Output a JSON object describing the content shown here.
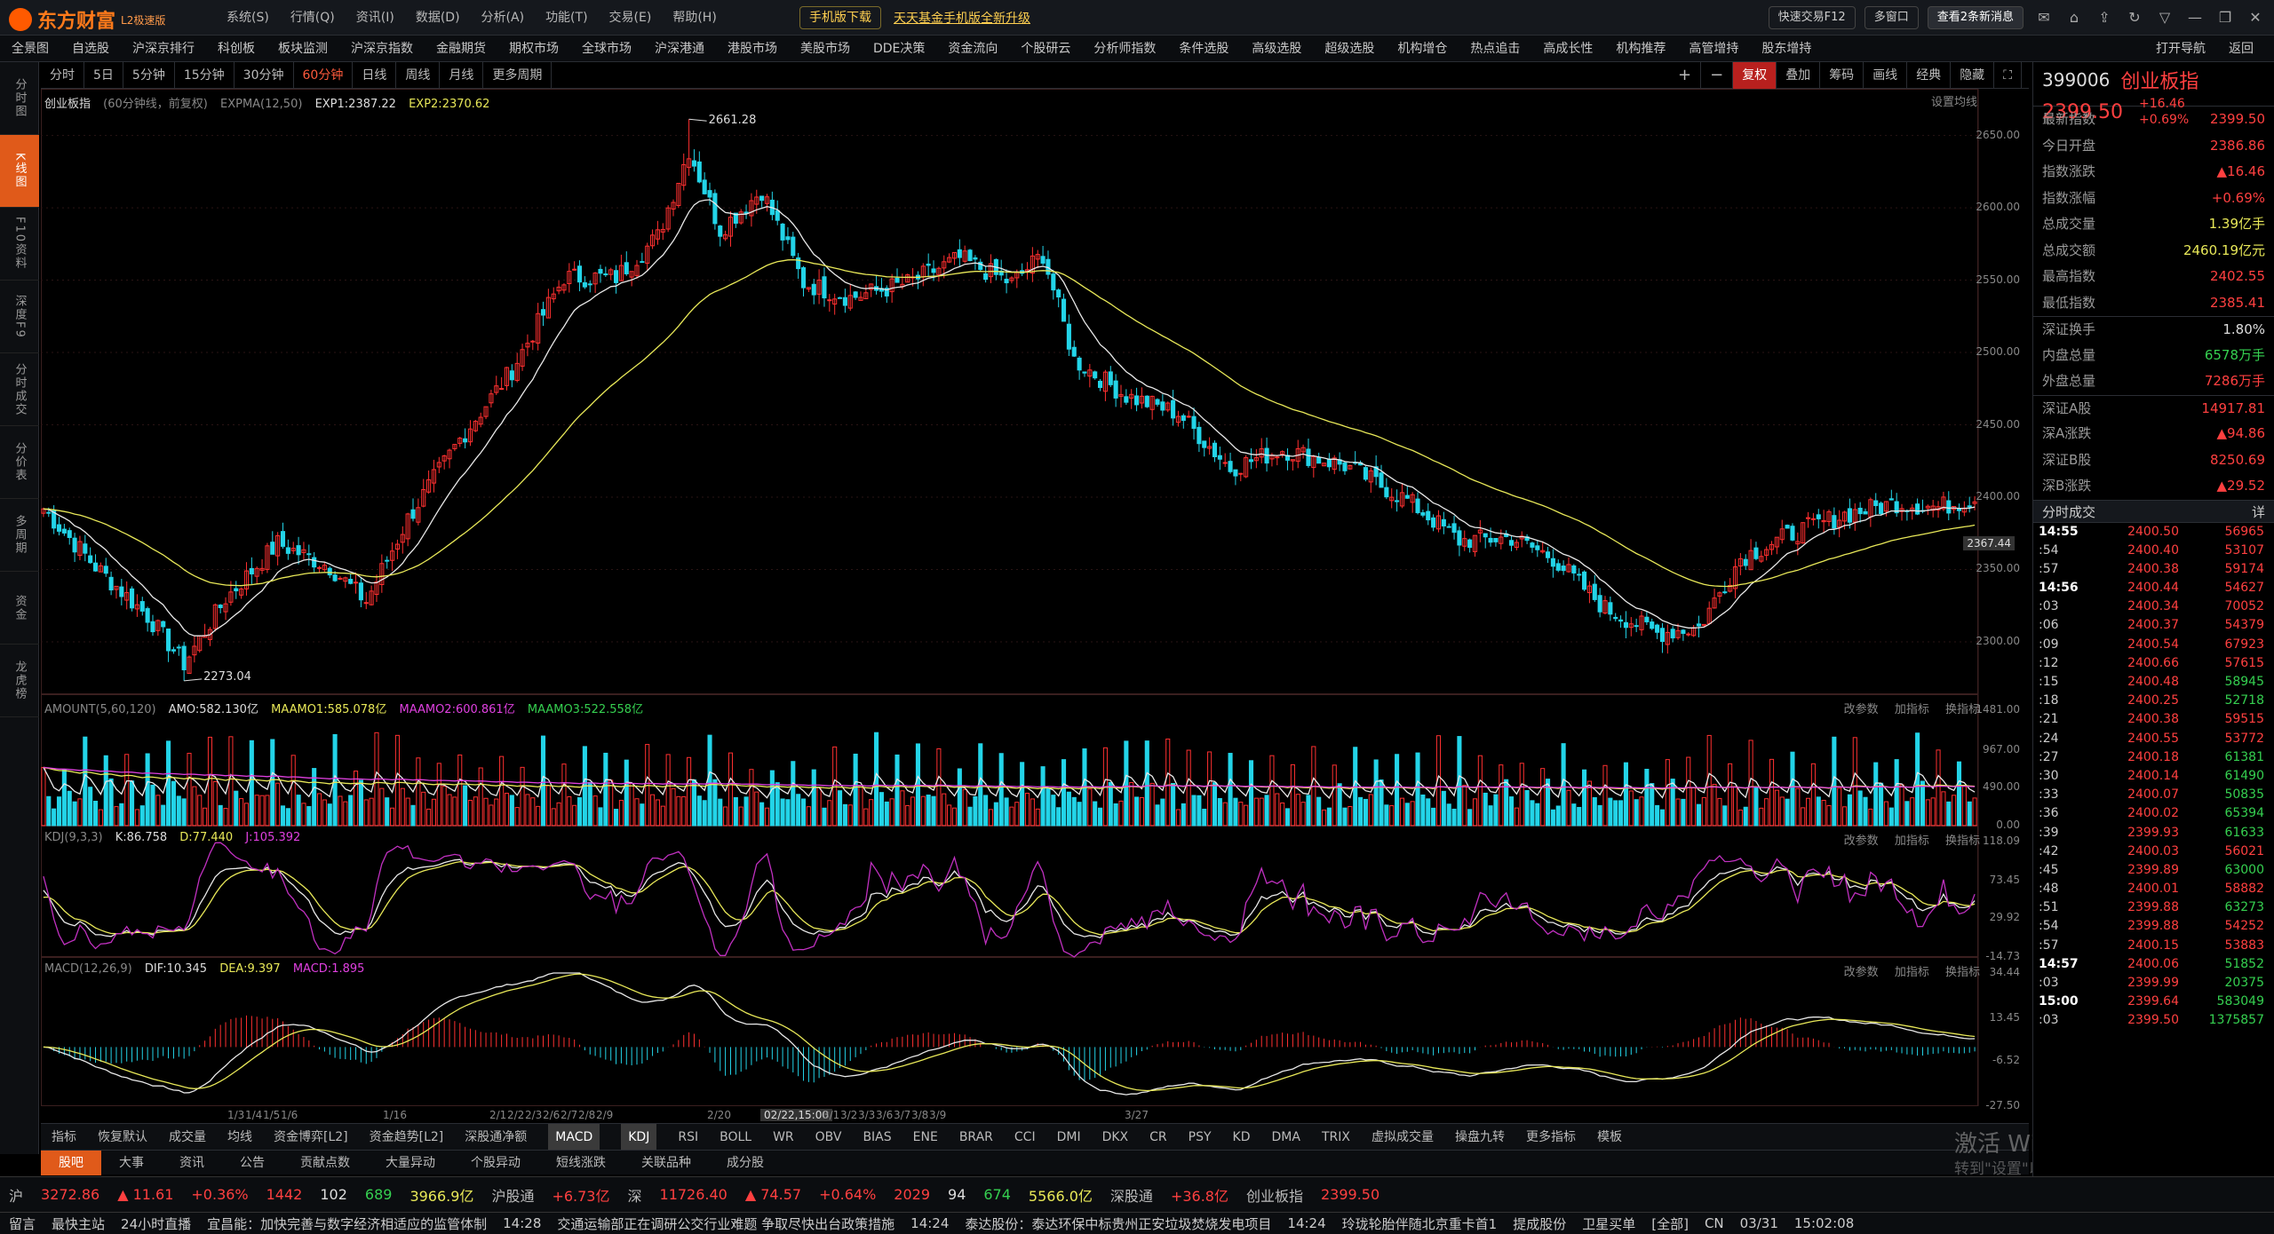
{
  "app": {
    "logo": "东方财富",
    "edition": "L2极速版"
  },
  "menu": [
    "系统(S)",
    "行情(Q)",
    "资讯(I)",
    "数据(D)",
    "分析(A)",
    "功能(T)",
    "交易(E)",
    "帮助(H)"
  ],
  "promo": {
    "download": "手机版下载",
    "link": "天天基金手机版全新升级"
  },
  "topright": {
    "quicktrade": "快速交易F12",
    "multiwin": "多窗口",
    "news": "查看2条新消息",
    "news_badge": "2"
  },
  "nav": [
    "全景图",
    "自选股",
    "沪深京排行",
    "科创板",
    "板块监测",
    "沪深京指数",
    "金融期货",
    "期权市场",
    "全球市场",
    "沪深港通",
    "港股市场",
    "美股市场",
    "DDE决策",
    "资金流向",
    "个股研云",
    "分析师指数",
    "条件选股",
    "高级选股",
    "超级选股",
    "机构增仓",
    "热点追击",
    "高成长性",
    "机构推荐",
    "高管增持",
    "股东增持"
  ],
  "nav_right": [
    "打开导航",
    "返回"
  ],
  "leftbar": [
    "分时图",
    "K线图",
    "F10资料",
    "深度F9",
    "分时成交",
    "分价表",
    "多周期",
    "资金",
    "龙虎榜"
  ],
  "periods": [
    "分时",
    "5日",
    "5分钟",
    "15分钟",
    "30分钟",
    "60分钟",
    "日线",
    "周线",
    "月线",
    "更多周期"
  ],
  "period_tools": [
    "复权",
    "叠加",
    "筹码",
    "画线",
    "经典",
    "隐藏"
  ],
  "main": {
    "name": "创业板指",
    "desc": "(60分钟线，前复权)",
    "ind": "EXPMA(12,50)",
    "exp1": "EXP1:2387.22",
    "exp2": "EXP2:2370.62",
    "setting": "设置均线",
    "hi_label": "2661.28",
    "lo_label": "2273.04",
    "focus_price": "2367.44"
  },
  "main_axis": [
    "2650.00",
    "2600.00",
    "2550.00",
    "2500.00",
    "2450.00",
    "2400.00",
    "2350.00",
    "2300.00"
  ],
  "vol": {
    "name": "AMOUNT(5,60,120)",
    "amo": "AMO:582.130亿",
    "m1": "MAAMO1:585.078亿",
    "m2": "MAAMO2:600.861亿",
    "m3": "MAAMO3:522.558亿"
  },
  "vol_axis": [
    "1481.00",
    "967.00",
    "490.00",
    "0.00"
  ],
  "kdj": {
    "name": "KDJ(9,3,3)",
    "k": "K:86.758",
    "d": "D:77.440",
    "j": "J:105.392"
  },
  "kdj_axis": [
    "118.09",
    "73.45",
    "29.92",
    "-14.73"
  ],
  "macd": {
    "name": "MACD(12,26,9)",
    "dif": "DIF:10.345",
    "dea": "DEA:9.397",
    "macd": "MACD:1.895"
  },
  "macd_axis": [
    "34.44",
    "13.45",
    "-6.52",
    "-27.50"
  ],
  "panel_btns": [
    "改参数",
    "加指标",
    "换指标"
  ],
  "xaxis": [
    "1/3",
    "1/4",
    "1/5",
    "1/6",
    "1/16",
    "2/1",
    "2/2",
    "2/3",
    "2/6",
    "2/7",
    "2/8",
    "2/9",
    "2/20",
    "02/22,15:00",
    "3/1",
    "3/2",
    "3/3",
    "3/6",
    "3/7",
    "3/8",
    "3/9",
    "3/27"
  ],
  "indicators": [
    "指标",
    "恢复默认",
    "成交量",
    "均线",
    "资金博弈[L2]",
    "资金趋势[L2]",
    "深股通净额",
    "MACD",
    "KDJ",
    "RSI",
    "BOLL",
    "WR",
    "OBV",
    "BIAS",
    "ENE",
    "BRAR",
    "CCI",
    "DMI",
    "DKX",
    "CR",
    "PSY",
    "KD",
    "DMA",
    "TRIX",
    "虚拟成交量",
    "操盘九转",
    "更多指标",
    "模板"
  ],
  "bottom_tabs": [
    "股吧",
    "大事",
    "资讯",
    "公告",
    "贡献点数",
    "大量异动",
    "个股异动",
    "短线涨跌",
    "关联品种",
    "成分股"
  ],
  "quote": {
    "code": "399006",
    "name": "创业板指",
    "price": "2399.50",
    "chg": "+16.46",
    "pct": "+0.69%"
  },
  "stats": [
    {
      "k": "最新指数",
      "v": "2399.50",
      "c": "red"
    },
    {
      "k": "今日开盘",
      "v": "2386.86",
      "c": "red"
    },
    {
      "k": "指数涨跌",
      "v": "▲16.46",
      "c": "red"
    },
    {
      "k": "指数涨幅",
      "v": "+0.69%",
      "c": "red"
    },
    {
      "k": "总成交量",
      "v": "1.39亿手",
      "c": "yellow"
    },
    {
      "k": "总成交额",
      "v": "2460.19亿元",
      "c": "yellow"
    },
    {
      "k": "最高指数",
      "v": "2402.55",
      "c": "red"
    },
    {
      "k": "最低指数",
      "v": "2385.41",
      "c": "red"
    },
    {
      "k": "深证换手",
      "v": "1.80%",
      "c": "white"
    },
    {
      "k": "内盘总量",
      "v": "6578万手",
      "c": "green"
    },
    {
      "k": "外盘总量",
      "v": "7286万手",
      "c": "red"
    },
    {
      "k": "深证A股",
      "v": "14917.81",
      "c": "red"
    },
    {
      "k": "深A涨跌",
      "v": "▲94.86",
      "c": "red"
    },
    {
      "k": "深证B股",
      "v": "8250.69",
      "c": "red"
    },
    {
      "k": "深B涨跌",
      "v": "▲29.52",
      "c": "red"
    }
  ],
  "ticks_title": "分时成交",
  "ticks_btn": "详",
  "ticks": [
    {
      "t": "14:55",
      "p": "2400.50",
      "v": "56965",
      "c": "red",
      "big": true
    },
    {
      "t": ":54",
      "p": "2400.40",
      "v": "53107",
      "c": "red"
    },
    {
      "t": ":57",
      "p": "2400.38",
      "v": "59174",
      "c": "red"
    },
    {
      "t": "14:56",
      "p": "2400.44",
      "v": "54627",
      "c": "red",
      "big": true
    },
    {
      "t": ":03",
      "p": "2400.34",
      "v": "70052",
      "c": "red"
    },
    {
      "t": ":06",
      "p": "2400.37",
      "v": "54379",
      "c": "red"
    },
    {
      "t": ":09",
      "p": "2400.54",
      "v": "67923",
      "c": "red"
    },
    {
      "t": ":12",
      "p": "2400.66",
      "v": "57615",
      "c": "red"
    },
    {
      "t": ":15",
      "p": "2400.48",
      "v": "58945",
      "c": "green"
    },
    {
      "t": ":18",
      "p": "2400.25",
      "v": "52718",
      "c": "green"
    },
    {
      "t": ":21",
      "p": "2400.38",
      "v": "59515",
      "c": "red"
    },
    {
      "t": ":24",
      "p": "2400.55",
      "v": "53772",
      "c": "red"
    },
    {
      "t": ":27",
      "p": "2400.18",
      "v": "61381",
      "c": "green"
    },
    {
      "t": ":30",
      "p": "2400.14",
      "v": "61490",
      "c": "green"
    },
    {
      "t": ":33",
      "p": "2400.07",
      "v": "50835",
      "c": "green"
    },
    {
      "t": ":36",
      "p": "2400.02",
      "v": "65394",
      "c": "green"
    },
    {
      "t": ":39",
      "p": "2399.93",
      "v": "61633",
      "c": "green"
    },
    {
      "t": ":42",
      "p": "2400.03",
      "v": "56021",
      "c": "red"
    },
    {
      "t": ":45",
      "p": "2399.89",
      "v": "63000",
      "c": "green"
    },
    {
      "t": ":48",
      "p": "2400.01",
      "v": "58882",
      "c": "red"
    },
    {
      "t": ":51",
      "p": "2399.88",
      "v": "63273",
      "c": "green"
    },
    {
      "t": ":54",
      "p": "2399.88",
      "v": "54252",
      "c": "red"
    },
    {
      "t": ":57",
      "p": "2400.15",
      "v": "53883",
      "c": "red"
    },
    {
      "t": "14:57",
      "p": "2400.06",
      "v": "51852",
      "c": "green",
      "big": true
    },
    {
      "t": ":03",
      "p": "2399.99",
      "v": "20375",
      "c": "green"
    },
    {
      "t": "15:00",
      "p": "2399.64",
      "v": "583049",
      "c": "green",
      "big": true
    },
    {
      "t": ":03",
      "p": "2399.50",
      "v": "1375857",
      "c": "green"
    }
  ],
  "status": [
    {
      "label": "沪",
      "v": "3272.86",
      "c": "red"
    },
    {
      "v": "▲ 11.61",
      "c": "red"
    },
    {
      "v": "+0.36%",
      "c": "red"
    },
    {
      "v": "1442",
      "c": "red"
    },
    {
      "v": "102",
      "c": "white"
    },
    {
      "v": "689",
      "c": "green"
    },
    {
      "v": "3966.9亿",
      "c": "yellow"
    },
    {
      "label": "沪股通",
      "v": "+6.73亿",
      "c": "red"
    },
    {
      "label": "深",
      "v": "11726.40",
      "c": "red"
    },
    {
      "v": "▲ 74.57",
      "c": "red"
    },
    {
      "v": "+0.64%",
      "c": "red"
    },
    {
      "v": "2029",
      "c": "red"
    },
    {
      "v": "94",
      "c": "white"
    },
    {
      "v": "674",
      "c": "green"
    },
    {
      "v": "5566.0亿",
      "c": "yellow"
    },
    {
      "label": "深股通",
      "v": "+36.8亿",
      "c": "red"
    },
    {
      "label": "创业板指",
      "v": "2399.50",
      "c": "red"
    }
  ],
  "news": [
    "留言",
    "最快主站",
    "24小时直播",
    "宜昌能：加快完善与数字经济相适应的监管体制",
    "14:28",
    "交通运输部正在调研公交行业难题 争取尽快出台政策措施",
    "14:24",
    "泰达股份：泰达环保中标贵州正安垃圾焚烧发电项目",
    "14:24",
    "玲珑轮胎伴随北京重卡首1",
    "提成股份",
    "卫星买单",
    "[全部]",
    "CN",
    "03/31",
    "15:02:08"
  ],
  "watermark": {
    "line1": "激活 Windows",
    "line2": "转到\"设置\"以激活 Windows。"
  },
  "chart_data": {
    "type": "candlestick",
    "title": "创业板指 (60分钟线，前复权)",
    "ylim": [
      2265,
      2670
    ],
    "hi": 2661.28,
    "lo": 2273.04,
    "anchors": [
      [
        0,
        2392
      ],
      [
        10,
        2352
      ],
      [
        20,
        2318
      ],
      [
        27,
        2285
      ],
      [
        35,
        2330
      ],
      [
        45,
        2368
      ],
      [
        55,
        2352
      ],
      [
        62,
        2328
      ],
      [
        70,
        2385
      ],
      [
        80,
        2440
      ],
      [
        90,
        2488
      ],
      [
        100,
        2552
      ],
      [
        110,
        2552
      ],
      [
        118,
        2580
      ],
      [
        124,
        2640
      ],
      [
        130,
        2585
      ],
      [
        138,
        2612
      ],
      [
        146,
        2548
      ],
      [
        155,
        2538
      ],
      [
        166,
        2548
      ],
      [
        176,
        2565
      ],
      [
        186,
        2548
      ],
      [
        192,
        2568
      ],
      [
        198,
        2495
      ],
      [
        208,
        2470
      ],
      [
        218,
        2458
      ],
      [
        228,
        2420
      ],
      [
        238,
        2433
      ],
      [
        250,
        2422
      ],
      [
        262,
        2398
      ],
      [
        272,
        2370
      ],
      [
        282,
        2372
      ],
      [
        290,
        2358
      ],
      [
        300,
        2323
      ],
      [
        310,
        2306
      ],
      [
        318,
        2310
      ],
      [
        326,
        2358
      ],
      [
        336,
        2375
      ],
      [
        346,
        2388
      ],
      [
        356,
        2396
      ],
      [
        364,
        2393
      ],
      [
        372,
        2400
      ]
    ],
    "n_bars": 372
  }
}
